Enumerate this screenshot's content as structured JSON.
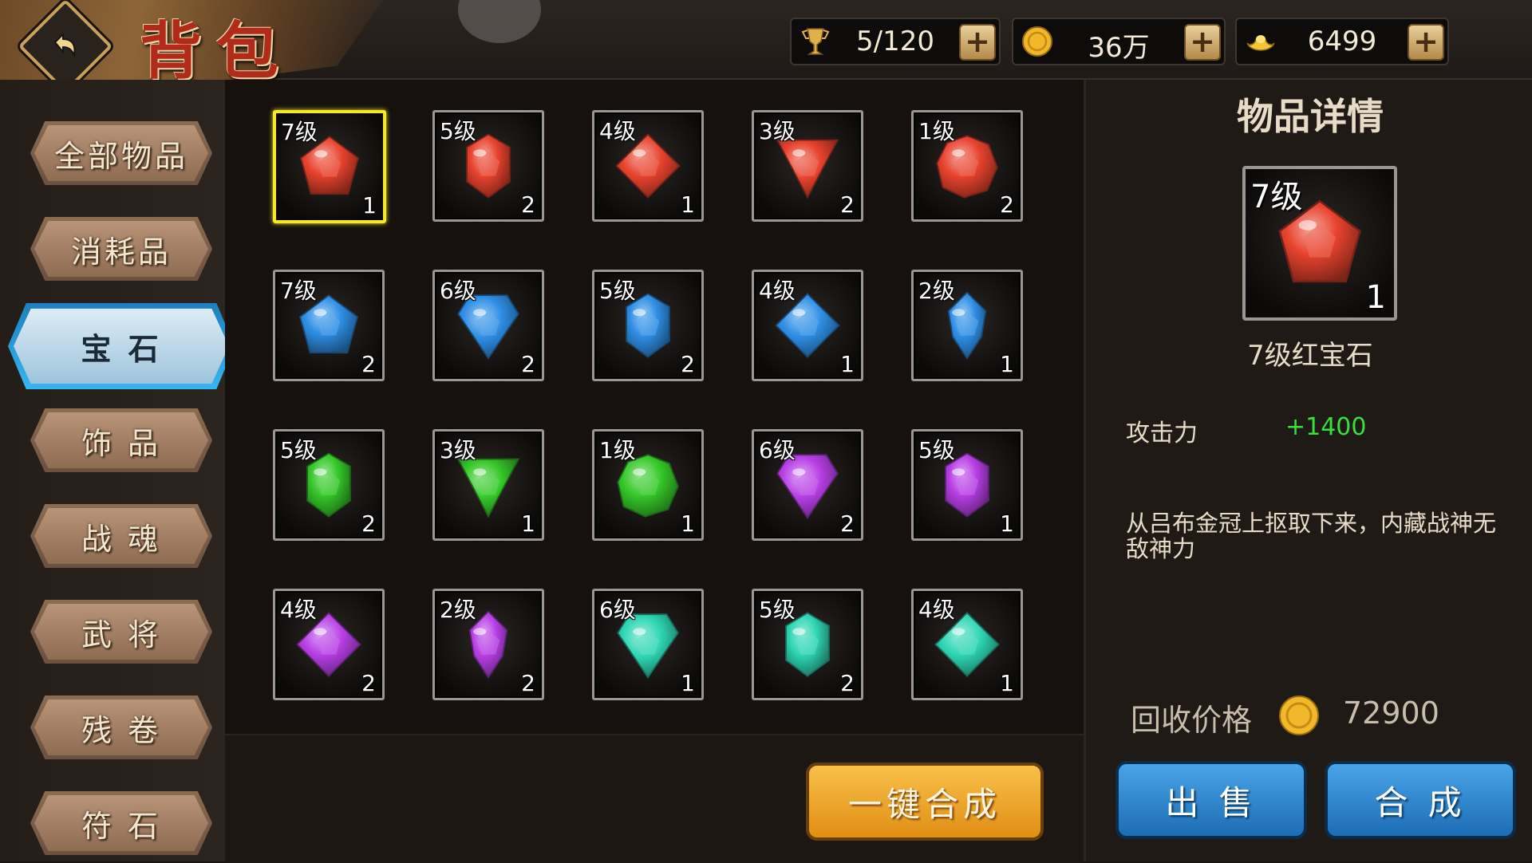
{
  "header": {
    "title": "背包",
    "resources": [
      {
        "name": "capacity",
        "icon": "trophy-icon",
        "value": "5/120"
      },
      {
        "name": "coins",
        "icon": "coin-icon",
        "value": "36万"
      },
      {
        "name": "gold",
        "icon": "gold-ingot-icon",
        "value": "6499"
      }
    ],
    "plus_label": "+"
  },
  "sidebar": {
    "items": [
      {
        "label": "全部物品",
        "active": false
      },
      {
        "label": "消耗品",
        "active": false
      },
      {
        "label": "宝 石",
        "active": true
      },
      {
        "label": "饰 品",
        "active": false
      },
      {
        "label": "战 魂",
        "active": false
      },
      {
        "label": "武 将",
        "active": false
      },
      {
        "label": "残 卷",
        "active": false
      },
      {
        "label": "符 石",
        "active": false
      }
    ]
  },
  "grid": {
    "items": [
      {
        "level": "7级",
        "count": "1",
        "color": "red",
        "shape": "pentagon",
        "selected": true
      },
      {
        "level": "5级",
        "count": "2",
        "color": "red",
        "shape": "hexagon"
      },
      {
        "level": "4级",
        "count": "1",
        "color": "red",
        "shape": "diamond"
      },
      {
        "level": "3级",
        "count": "2",
        "color": "red",
        "shape": "triangle"
      },
      {
        "level": "1级",
        "count": "2",
        "color": "red",
        "shape": "round"
      },
      {
        "level": "7级",
        "count": "2",
        "color": "blue",
        "shape": "pentagon"
      },
      {
        "level": "6级",
        "count": "2",
        "color": "blue",
        "shape": "kite"
      },
      {
        "level": "5级",
        "count": "2",
        "color": "blue",
        "shape": "hexagon"
      },
      {
        "level": "4级",
        "count": "1",
        "color": "blue",
        "shape": "diamond"
      },
      {
        "level": "2级",
        "count": "1",
        "color": "blue",
        "shape": "drop"
      },
      {
        "level": "5级",
        "count": "2",
        "color": "green",
        "shape": "hexagon"
      },
      {
        "level": "3级",
        "count": "1",
        "color": "green",
        "shape": "triangle"
      },
      {
        "level": "1级",
        "count": "1",
        "color": "green",
        "shape": "round"
      },
      {
        "level": "6级",
        "count": "2",
        "color": "purple",
        "shape": "kite"
      },
      {
        "level": "5级",
        "count": "1",
        "color": "purple",
        "shape": "hexagon"
      },
      {
        "level": "4级",
        "count": "2",
        "color": "purple",
        "shape": "diamond"
      },
      {
        "level": "2级",
        "count": "2",
        "color": "purple",
        "shape": "drop"
      },
      {
        "level": "6级",
        "count": "1",
        "color": "teal",
        "shape": "kite"
      },
      {
        "level": "5级",
        "count": "2",
        "color": "teal",
        "shape": "hexagon"
      },
      {
        "level": "4级",
        "count": "1",
        "color": "teal",
        "shape": "diamond"
      }
    ]
  },
  "gem_colors": {
    "red": "#e8432e",
    "blue": "#2f8fe6",
    "green": "#36c92a",
    "purple": "#b83fe6",
    "teal": "#2fd6b4"
  },
  "detail": {
    "title": "物品详情",
    "level": "7级",
    "count": "1",
    "name": "7级红宝石",
    "stat_label": "攻击力",
    "stat_value": "+1400",
    "description": "从吕布金冠上抠取下来，内藏战神无敌神力",
    "price_label": "回收价格",
    "price_value": "72900"
  },
  "buttons": {
    "combine_all": "一键合成",
    "sell": "出 售",
    "synthesize": "合 成"
  }
}
